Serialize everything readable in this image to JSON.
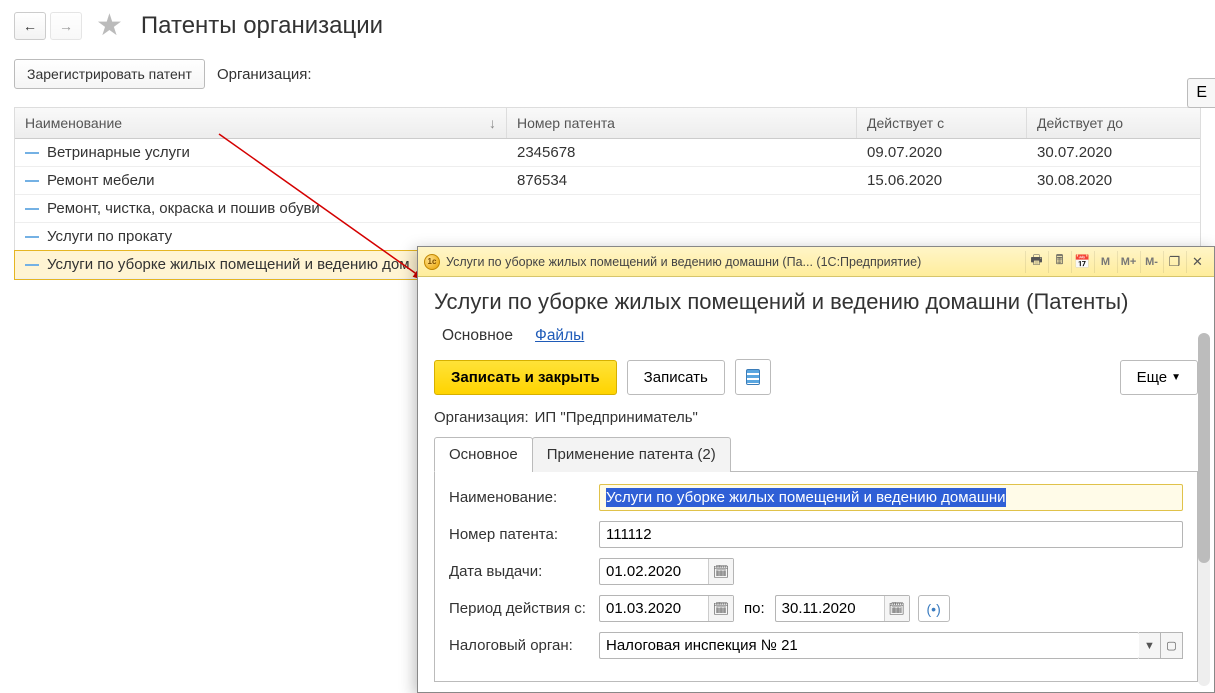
{
  "page": {
    "title": "Патенты организации"
  },
  "nav": {
    "back": "←",
    "fwd": "→"
  },
  "toolbar": {
    "register": "Зарегистрировать патент",
    "org_label": "Организация:"
  },
  "topmore": "Е",
  "grid": {
    "headers": {
      "name": "Наименование",
      "num": "Номер патента",
      "from": "Действует с",
      "to": "Действует до"
    },
    "sort": "↓",
    "rows": [
      {
        "name": "Ветринарные услуги",
        "num": "2345678",
        "from": "09.07.2020",
        "to": "30.07.2020"
      },
      {
        "name": "Ремонт мебели",
        "num": "876534",
        "from": "15.06.2020",
        "to": "30.08.2020"
      },
      {
        "name": "Ремонт, чистка, окраска и пошив обуви",
        "num": "",
        "from": "",
        "to": ""
      },
      {
        "name": "Услуги по прокату",
        "num": "",
        "from": "",
        "to": ""
      },
      {
        "name": "Услуги по уборке жилых помещений и ведению дом",
        "num": "",
        "from": "",
        "to": ""
      }
    ]
  },
  "popup": {
    "titlebar": "Услуги по уборке жилых помещений и ведению домашни (Па...   (1С:Предприятие)",
    "title": "Услуги по уборке жилых помещений и ведению домашни (Патенты)",
    "sublinks": {
      "main": "Основное",
      "files": "Файлы"
    },
    "cmd": {
      "save_close": "Записать и закрыть",
      "save": "Записать",
      "more": "Еще"
    },
    "org": {
      "label": "Организация:",
      "value": "ИП \"Предприниматель\""
    },
    "tabs": {
      "main": "Основное",
      "apply": "Применение патента (2)"
    },
    "fields": {
      "name_label": "Наименование:",
      "name_value": "Услуги по уборке жилых помещений и ведению домашни",
      "num_label": "Номер патента:",
      "num_value": "111112",
      "date_label": "Дата выдачи:",
      "date_value": "01.02.2020",
      "period_label": "Период действия с:",
      "period_from": "01.03.2020",
      "period_to_label": "по:",
      "period_to": "30.11.2020",
      "tax_label": "Налоговый орган:",
      "tax_value": "Налоговая инспекция № 21"
    },
    "winbtns": {
      "m": "M",
      "mp": "M+",
      "mm": "M-",
      "rest": "❐",
      "close": "✕"
    }
  }
}
